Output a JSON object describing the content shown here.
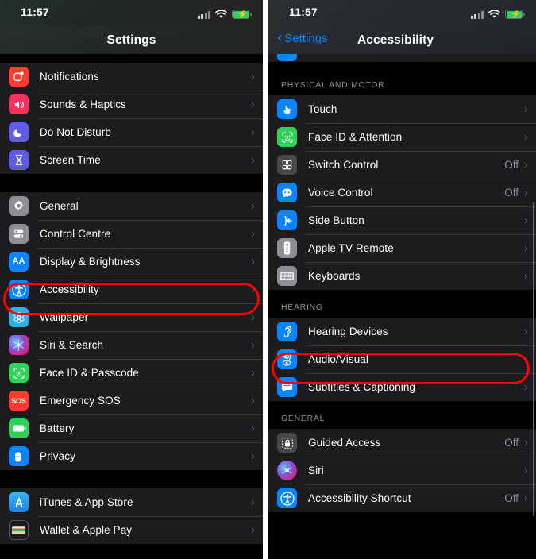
{
  "left_phone": {
    "status_bar": {
      "time": "11:57",
      "cellular": "signal-bars",
      "wifi": "wifi",
      "battery": "battery-charging"
    },
    "nav": {
      "title": "Settings"
    },
    "groups": [
      {
        "items": [
          {
            "label": "Notifications",
            "icon": "notifications-icon",
            "value": ""
          },
          {
            "label": "Sounds & Haptics",
            "icon": "sounds-icon",
            "value": ""
          },
          {
            "label": "Do Not Disturb",
            "icon": "moon-icon",
            "value": ""
          },
          {
            "label": "Screen Time",
            "icon": "hourglass-icon",
            "value": ""
          }
        ]
      },
      {
        "items": [
          {
            "label": "General",
            "icon": "gear-icon",
            "value": ""
          },
          {
            "label": "Control Centre",
            "icon": "sliders-icon",
            "value": ""
          },
          {
            "label": "Display & Brightness",
            "icon": "aa-icon",
            "value": ""
          },
          {
            "label": "Accessibility",
            "icon": "accessibility-icon",
            "value": "",
            "highlighted": true
          },
          {
            "label": "Wallpaper",
            "icon": "wallpaper-icon",
            "value": ""
          },
          {
            "label": "Siri & Search",
            "icon": "siri-icon",
            "value": ""
          },
          {
            "label": "Face ID & Passcode",
            "icon": "faceid-icon",
            "value": ""
          },
          {
            "label": "Emergency SOS",
            "icon": "sos-icon",
            "value": ""
          },
          {
            "label": "Battery",
            "icon": "battery-icon",
            "value": ""
          },
          {
            "label": "Privacy",
            "icon": "hand-icon",
            "value": ""
          }
        ]
      },
      {
        "items": [
          {
            "label": "iTunes & App Store",
            "icon": "appstore-icon",
            "value": ""
          },
          {
            "label": "Wallet & Apple Pay",
            "icon": "wallet-icon",
            "value": ""
          }
        ]
      }
    ]
  },
  "right_phone": {
    "status_bar": {
      "time": "11:57",
      "cellular": "signal-bars",
      "wifi": "wifi",
      "battery": "battery-charging"
    },
    "nav": {
      "back_label": "Settings",
      "title": "Accessibility"
    },
    "sections": [
      {
        "header": "PHYSICAL AND MOTOR",
        "items": [
          {
            "label": "Touch",
            "icon": "touch-icon",
            "value": ""
          },
          {
            "label": "Face ID & Attention",
            "icon": "faceid-icon",
            "value": ""
          },
          {
            "label": "Switch Control",
            "icon": "switch-control-icon",
            "value": "Off"
          },
          {
            "label": "Voice Control",
            "icon": "voice-control-icon",
            "value": "Off"
          },
          {
            "label": "Side Button",
            "icon": "side-button-icon",
            "value": ""
          },
          {
            "label": "Apple TV Remote",
            "icon": "tv-remote-icon",
            "value": ""
          },
          {
            "label": "Keyboards",
            "icon": "keyboard-icon",
            "value": ""
          }
        ]
      },
      {
        "header": "HEARING",
        "items": [
          {
            "label": "Hearing Devices",
            "icon": "ear-icon",
            "value": ""
          },
          {
            "label": "Audio/Visual",
            "icon": "audio-visual-icon",
            "value": "",
            "highlighted": true
          },
          {
            "label": "Subtitles & Captioning",
            "icon": "captioning-icon",
            "value": ""
          }
        ]
      },
      {
        "header": "GENERAL",
        "items": [
          {
            "label": "Guided Access",
            "icon": "lock-icon",
            "value": "Off"
          },
          {
            "label": "Siri",
            "icon": "siri-icon",
            "value": ""
          },
          {
            "label": "Accessibility Shortcut",
            "icon": "accessibility-icon",
            "value": "Off"
          }
        ]
      }
    ]
  },
  "annotations": {
    "highlight_color": "#ff0000",
    "left_highlight_target": "Accessibility",
    "right_highlight_target": "Audio/Visual"
  }
}
